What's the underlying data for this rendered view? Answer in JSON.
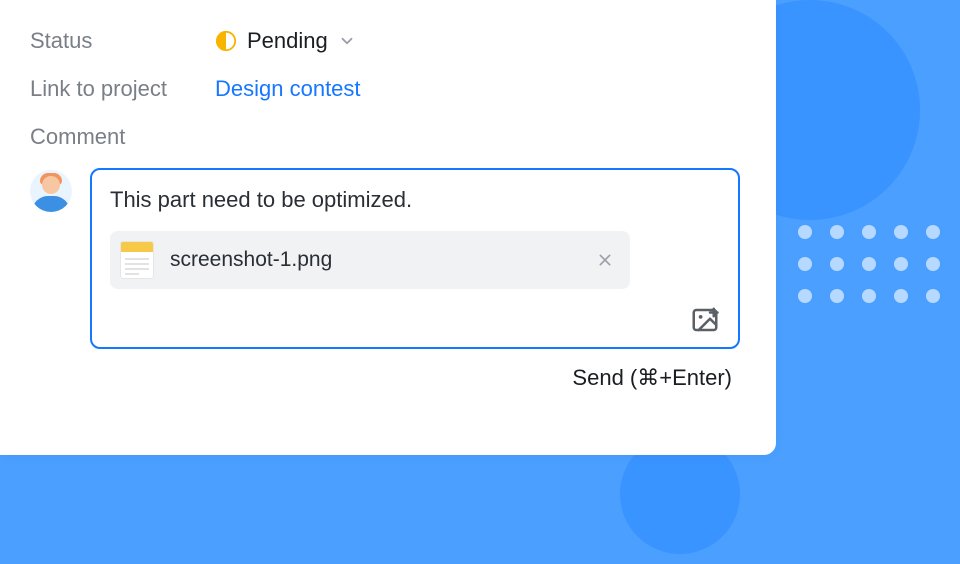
{
  "fields": {
    "status": {
      "label": "Status",
      "value": "Pending"
    },
    "link_to_project": {
      "label": "Link to project",
      "value": "Design contest"
    },
    "comment": {
      "label": "Comment",
      "text": "This part need to be optimized.",
      "attachment": {
        "filename": "screenshot-1.png"
      }
    }
  },
  "actions": {
    "send_label": "Send (⌘+Enter)"
  }
}
